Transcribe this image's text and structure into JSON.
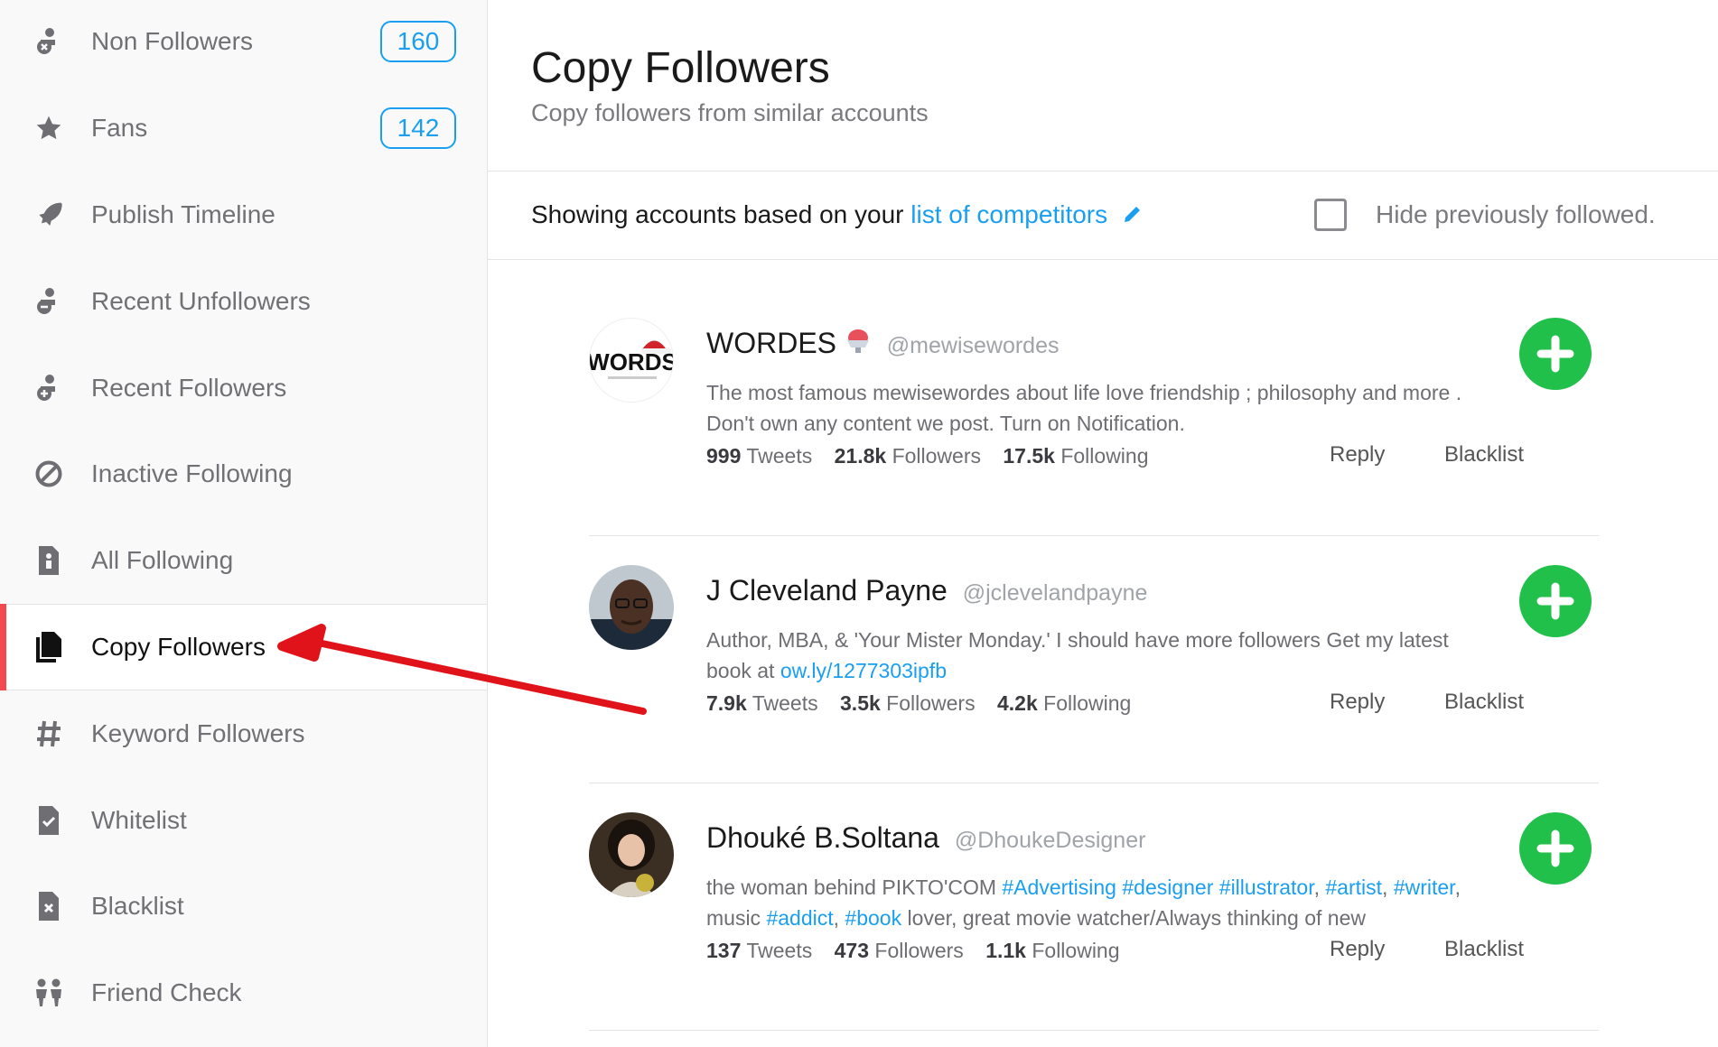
{
  "sidebar": {
    "items": [
      {
        "label": "Non Followers",
        "badge": "160",
        "icon": "person-x-icon"
      },
      {
        "label": "Fans",
        "badge": "142",
        "icon": "star-icon"
      },
      {
        "label": "Publish Timeline",
        "icon": "rocket-icon"
      },
      {
        "label": "Recent Unfollowers",
        "icon": "person-minus-icon"
      },
      {
        "label": "Recent Followers",
        "icon": "person-plus-icon"
      },
      {
        "label": "Inactive Following",
        "icon": "ban-icon"
      },
      {
        "label": "All Following",
        "icon": "document-person-icon"
      },
      {
        "label": "Copy Followers",
        "icon": "copy-icon",
        "active": true
      },
      {
        "label": "Keyword Followers",
        "icon": "hashtag-icon"
      },
      {
        "label": "Whitelist",
        "icon": "document-check-icon"
      },
      {
        "label": "Blacklist",
        "icon": "document-x-icon"
      },
      {
        "label": "Friend Check",
        "icon": "people-icon"
      }
    ]
  },
  "header": {
    "title": "Copy Followers",
    "subtitle": "Copy followers from similar accounts"
  },
  "filter": {
    "prefix": "Showing accounts based on your ",
    "link": "list of competitors",
    "hide_label": "Hide previously followed.",
    "hide_checked": false
  },
  "accounts": [
    {
      "name": "WORDES",
      "handle": "@mewisewordes",
      "bio": "The most famous mewisewordes about life love friendship ; philosophy and more . Don't own any content we post. Turn on Notification.",
      "tweets": "999",
      "tweets_label": "Tweets",
      "followers": "21.8k",
      "followers_label": "Followers",
      "following": "17.5k",
      "following_label": "Following",
      "reply": "Reply",
      "blacklist": "Blacklist",
      "avatar_text": "WORDS"
    },
    {
      "name": "J Cleveland Payne",
      "handle": "@jclevelandpayne",
      "bio_text": "Author, MBA, & 'Your Mister Monday.' I should have more followers Get my latest book at ",
      "bio_link": "ow.ly/1277303ipfb",
      "tweets": "7.9k",
      "tweets_label": "Tweets",
      "followers": "3.5k",
      "followers_label": "Followers",
      "following": "4.2k",
      "following_label": "Following",
      "reply": "Reply",
      "blacklist": "Blacklist"
    },
    {
      "name": "Dhouké B.Soltana",
      "handle": "@DhoukeDesigner",
      "bio_parts": {
        "t1": "the woman behind PIKTO'COM ",
        "l1": "#Advertising",
        "l2": "#designer",
        "l3": "#illustrator",
        "l4": "#artist",
        "l5": "#writer",
        "t2": ", music ",
        "l6": "#addict",
        "l7": "#book",
        "t3": " lover, great movie watcher/Always thinking of new"
      },
      "tweets": "137",
      "tweets_label": "Tweets",
      "followers": "473",
      "followers_label": "Followers",
      "following": "1.1k",
      "following_label": "Following",
      "reply": "Reply",
      "blacklist": "Blacklist"
    }
  ],
  "colors": {
    "accent": "#1a9ff0",
    "active_marker": "#f24a4e",
    "add_button": "#21c04a",
    "annotation_arrow": "#e0131a"
  }
}
